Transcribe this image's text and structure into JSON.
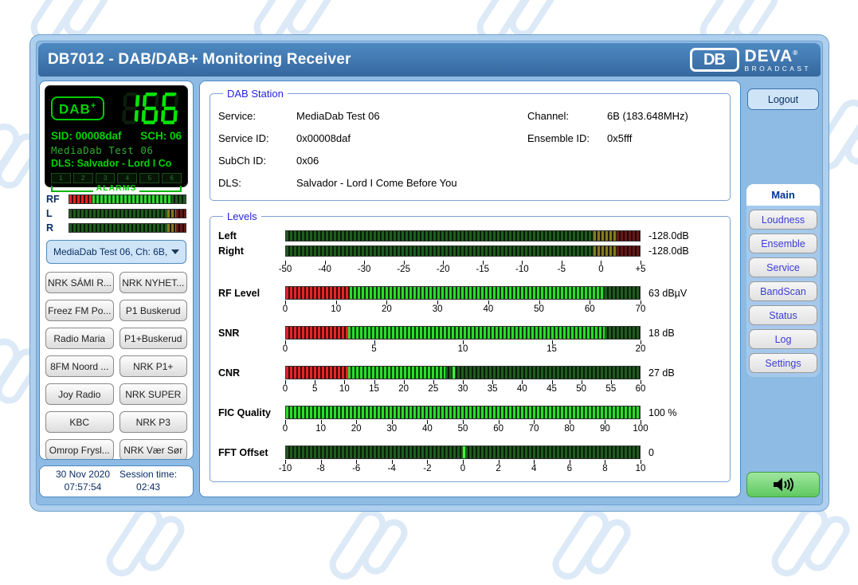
{
  "header": {
    "title": "DB7012 - DAB/DAB+ Monitoring Receiver",
    "logo_db": "DB",
    "logo_main": "DEVA",
    "logo_reg": "®",
    "logo_sub": "BROADCAST"
  },
  "lcd": {
    "badge_main": "DAB",
    "badge_plus": "+",
    "digits": "166",
    "sid_text": "SID: 00008daf",
    "sch_text": "SCH: 06",
    "service_name": "MediaDab Test 06",
    "dls_text": "DLS: Salvador - Lord I Co",
    "alarm_indicators": [
      "1",
      "2",
      "3",
      "4",
      "5",
      "6"
    ],
    "alarms_label": "ALARMS"
  },
  "mini_meters": [
    {
      "label": "RF",
      "segs": [
        [
          "red",
          20
        ],
        [
          "green",
          68
        ],
        [
          "dimgreen",
          12
        ]
      ]
    },
    {
      "label": "L",
      "segs": [
        [
          "dimgreen",
          84
        ],
        [
          "dimyellow",
          8
        ],
        [
          "dimred",
          8
        ]
      ]
    },
    {
      "label": "R",
      "segs": [
        [
          "dimgreen",
          84
        ],
        [
          "dimyellow",
          8
        ],
        [
          "dimred",
          8
        ]
      ]
    }
  ],
  "station_select": {
    "value": "MediaDab Test 06, Ch: 6B,..."
  },
  "station_buttons": [
    "NRK SÁMI R...",
    "NRK NYHET...",
    "Freez FM Po...",
    "P1 Buskerud",
    "Radio Maria",
    "P1+Buskerud",
    "8FM Noord ...",
    "NRK P1+",
    "Joy Radio",
    "NRK SUPER",
    "KBC",
    "NRK P3",
    "Omrop Frysl...",
    "NRK Vær Sør"
  ],
  "clock": {
    "date": "30 Nov 2020",
    "time": "07:57:54",
    "session_label": "Session time:",
    "session_value": "02:43"
  },
  "dab_station": {
    "legend": "DAB Station",
    "rows": [
      {
        "l1": "Service:",
        "v1": "MediaDab Test 06",
        "l2": "Channel:",
        "v2": "6B (183.648MHz)"
      },
      {
        "l1": "Service ID:",
        "v1": "0x00008daf",
        "l2": "Ensemble ID:",
        "v2": "0x5fff"
      },
      {
        "l1": "SubCh ID:",
        "v1": "0x06",
        "l2": "",
        "v2": ""
      },
      {
        "l1": "DLS:",
        "v1": "Salvador - Lord I Come Before You",
        "l2": "",
        "v2": ""
      }
    ]
  },
  "levels": {
    "legend": "Levels",
    "meters": [
      {
        "id": "left",
        "label": "Left",
        "value": "-128.0dB",
        "h": 14,
        "cls": "lr",
        "segs": [
          [
            "dimgreen",
            87
          ],
          [
            "dimyellow",
            6.5
          ],
          [
            "dimred",
            6.5
          ]
        ]
      },
      {
        "id": "right",
        "label": "Right",
        "value": "-128.0dB",
        "h": 14,
        "cls": "lr",
        "segs": [
          [
            "dimgreen",
            87
          ],
          [
            "dimyellow",
            6.5
          ],
          [
            "dimred",
            6.5
          ]
        ],
        "ticks": [
          "-50",
          "-40",
          "-30",
          "-25",
          "-20",
          "-15",
          "-10",
          "-5",
          "0",
          "+5"
        ]
      },
      {
        "id": "rf",
        "label": "RF Level",
        "value": "63 dBµV",
        "h": 17,
        "gap": true,
        "segs": [
          [
            "red",
            18
          ],
          [
            "green",
            72
          ],
          [
            "dimgreen",
            10
          ]
        ],
        "ticks": [
          "0",
          "10",
          "20",
          "30",
          "40",
          "50",
          "60",
          "70"
        ]
      },
      {
        "id": "snr",
        "label": "SNR",
        "value": "18 dB",
        "h": 17,
        "gap": true,
        "segs": [
          [
            "red",
            17.5
          ],
          [
            "green",
            72.5
          ],
          [
            "dimgreen",
            10
          ]
        ],
        "ticks": [
          "0",
          "5",
          "10",
          "15",
          "20"
        ]
      },
      {
        "id": "cnr",
        "label": "CNR",
        "value": "27 dB",
        "h": 17,
        "gap": true,
        "peak": 47,
        "segs": [
          [
            "red",
            17.5
          ],
          [
            "green",
            27.5
          ],
          [
            "dimgreen",
            55
          ]
        ],
        "ticks": [
          "0",
          "5",
          "10",
          "15",
          "20",
          "25",
          "30",
          "35",
          "40",
          "45",
          "50",
          "55",
          "60"
        ]
      },
      {
        "id": "fic",
        "label": "FIC Quality",
        "value": "100 %",
        "h": 17,
        "gap": true,
        "segs": [
          [
            "green",
            100
          ]
        ],
        "ticks": [
          "0",
          "10",
          "20",
          "30",
          "40",
          "50",
          "60",
          "70",
          "80",
          "90",
          "100"
        ]
      },
      {
        "id": "fft",
        "label": "FFT Offset",
        "value": "0",
        "h": 17,
        "gap": true,
        "peak": 50,
        "segs": [
          [
            "dimgreen",
            100
          ]
        ],
        "ticks": [
          "-10",
          "-8",
          "-6",
          "-4",
          "-2",
          "0",
          "2",
          "4",
          "6",
          "8",
          "10"
        ]
      }
    ]
  },
  "sidebar": {
    "logout_label": "Logout",
    "active_tab": "Main",
    "nav": [
      "Loudness",
      "Ensemble",
      "Service",
      "BandScan",
      "Status",
      "Log",
      "Settings"
    ]
  },
  "colors": {
    "header_blue": "#3b74ad",
    "window_blue": "#8dbbe4",
    "lcd_green": "#00d400",
    "meter_green": "#29dd29",
    "meter_red": "#e42525",
    "nav_text": "#3c3cd6",
    "speaker_green": "#7fd97f"
  }
}
